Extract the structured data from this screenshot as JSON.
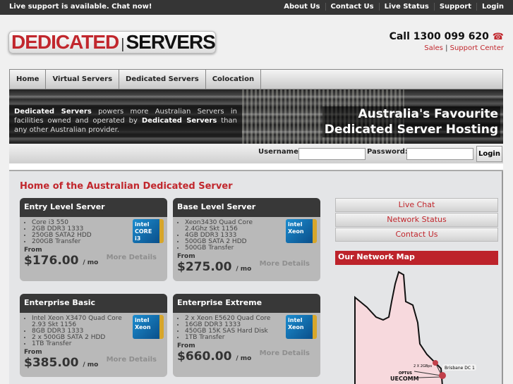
{
  "topbar": {
    "message": "Live support is available. Chat now!",
    "links": [
      "About Us",
      "Contact Us",
      "Live Status",
      "Support",
      "Login"
    ]
  },
  "logo": {
    "part1": "DEDICATED",
    "part2": "SERVERS"
  },
  "header": {
    "call": "Call 1300 099 620",
    "links": [
      "Sales",
      "Support Center"
    ],
    "separator": "|",
    "phone_icon": "phone-icon"
  },
  "nav": [
    "Home",
    "Virtual Servers",
    "Dedicated Servers",
    "Colocation"
  ],
  "banner": {
    "blurb_b1": "Dedicated Servers",
    "blurb_t1": " powers more Australian Servers in facilities owned and operated by ",
    "blurb_b2": "Dedicated Servers",
    "blurb_t2": " than any other Australian provider.",
    "tag1": "Australia's Favourite",
    "tag2": "Dedicated Server Hosting"
  },
  "login": {
    "username_label": "Username:",
    "password_label": "Password:",
    "username": "",
    "password": "",
    "button": "Login"
  },
  "main": {
    "heading": "Home of the Australian Dedicated Server",
    "plans": [
      {
        "name": "Entry Level Server",
        "features": [
          "Core i3 550",
          "2GB DDR3 1333",
          "250GB SATA2 HDD",
          "200GB Transfer"
        ],
        "from": "From",
        "price": "$176.00",
        "per": "/ mo",
        "more": "More Details",
        "chip": "intel CORE i3"
      },
      {
        "name": "Base Level Server",
        "features": [
          "Xeon3430 Quad Core 2.4Ghz Skt 1156",
          "4GB DDR3 1333",
          "500GB SATA 2 HDD",
          "500GB Transfer"
        ],
        "from": "From",
        "price": "$275.00",
        "per": "/ mo",
        "more": "More Details",
        "chip": "intel Xeon"
      },
      {
        "name": "Enterprise Basic",
        "features": [
          "Intel Xeon X3470 Quad Core 2.93 Skt 1156",
          "8GB DDR3 1333",
          "2 x 500GB SATA 2 HDD",
          "1TB Transfer"
        ],
        "from": "From",
        "price": "$385.00",
        "per": "/ mo",
        "more": "More Details",
        "chip": "intel Xeon"
      },
      {
        "name": "Enterprise Extreme",
        "features": [
          "2 x Xeon E5620 Quad Core",
          "16GB DDR3 1333",
          "450GB 15K SAS Hard Disk",
          "1TB Transfer"
        ],
        "from": "From",
        "price": "$660.00",
        "per": "/ mo",
        "more": "More Details",
        "chip": "intel Xeon"
      }
    ]
  },
  "sidebar": {
    "links": [
      "Live Chat",
      "Network Status",
      "Contact Us"
    ],
    "map_title": "Our Network Map",
    "map_labels": {
      "dc": "Brisbane DC 1",
      "link": "2 X 2GBps",
      "optus": "OPTUS",
      "uecomm": "UECOMM"
    }
  },
  "colors": {
    "accent": "#c1272d",
    "topbar": "#353535",
    "card_header": "#383838"
  }
}
